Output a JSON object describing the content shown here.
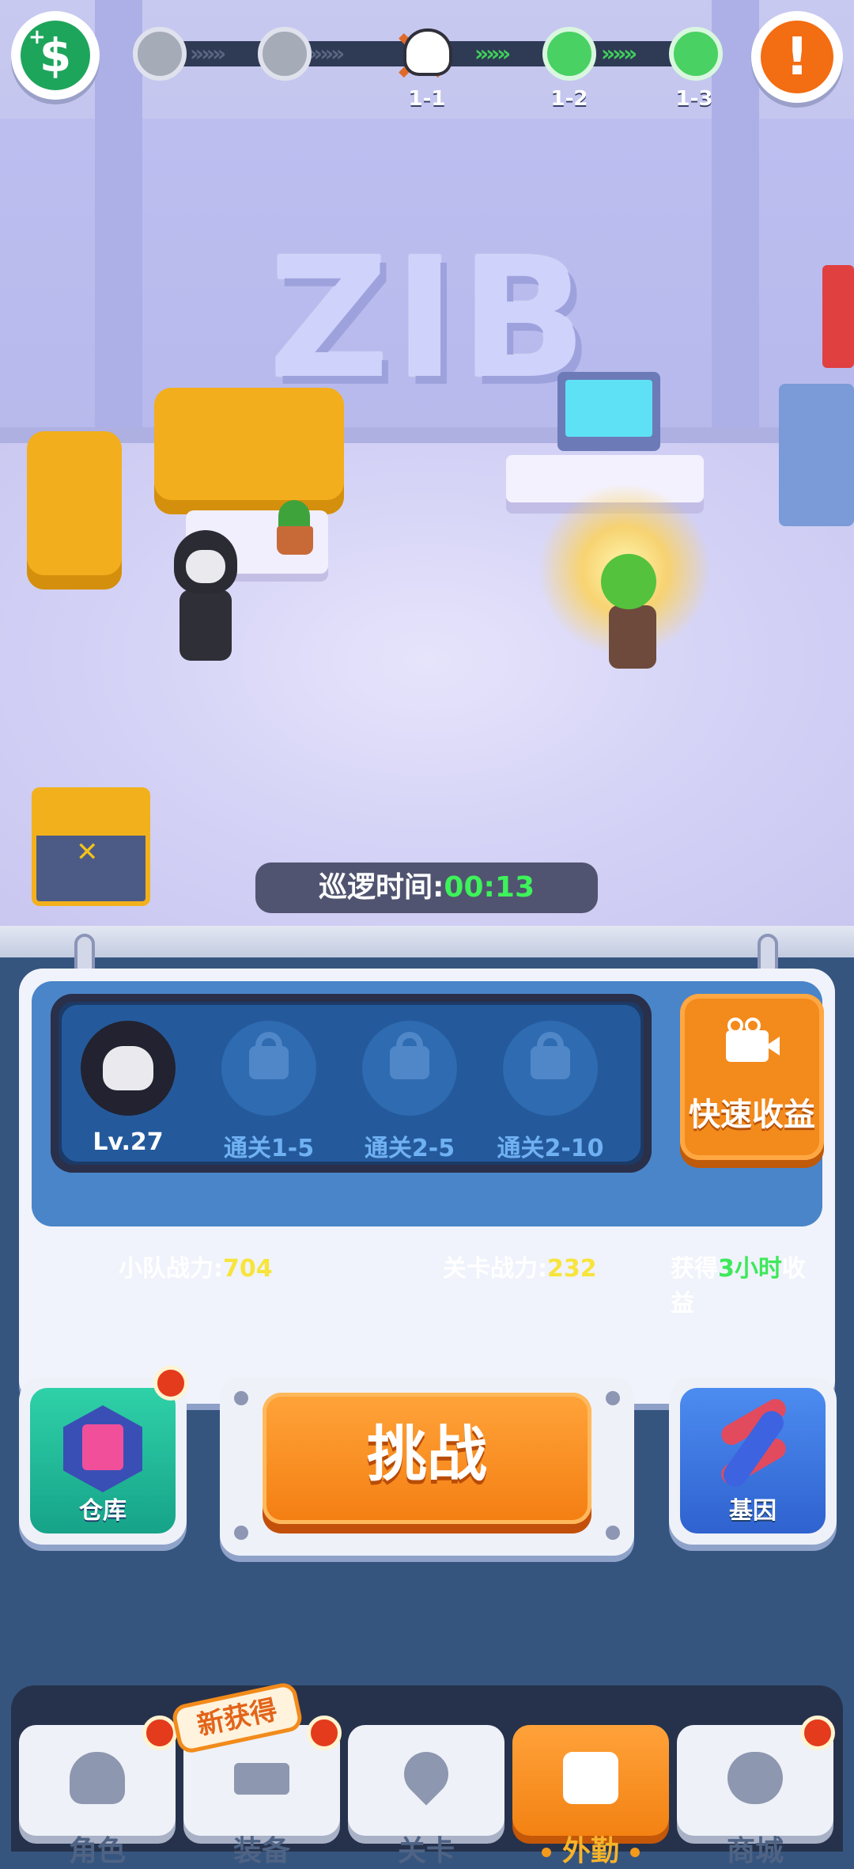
{
  "top_bar": {
    "stage_labels": [
      "1-1",
      "1-2",
      "1-3"
    ]
  },
  "scene": {
    "wall_logo": "ZIB",
    "patrol_label": "巡逻时间:",
    "patrol_time": "00:13"
  },
  "squad": {
    "slots": [
      {
        "label": "Lv.27",
        "locked": false
      },
      {
        "label": "通关1-5",
        "locked": true
      },
      {
        "label": "通关2-5",
        "locked": true
      },
      {
        "label": "通关2-10",
        "locked": true
      }
    ],
    "quick_earn_label": "快速收益",
    "team_power_label": "小队战力:",
    "team_power": "704",
    "stage_power_label": "关卡战力:",
    "stage_power": "232",
    "reward_prefix": "获得",
    "reward_hours": "3小时",
    "reward_suffix": "收益"
  },
  "actions": {
    "warehouse_label": "仓库",
    "challenge_label": "挑战",
    "gene_label": "基因"
  },
  "nav": {
    "new_badge": "新获得",
    "tabs": [
      "角色",
      "装备",
      "关卡",
      "外勤",
      "商城"
    ],
    "active_tab": "外勤"
  },
  "colors": {
    "accent_orange": "#f38212",
    "timer_green": "#3df25a",
    "power_yellow": "#f7e43c",
    "panel_blue": "#4a85c9"
  }
}
